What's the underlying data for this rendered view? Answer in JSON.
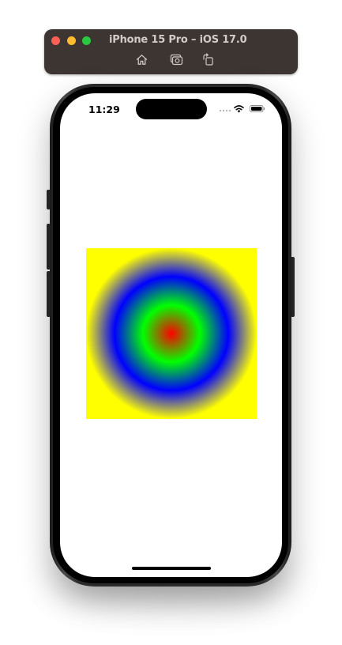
{
  "simulator": {
    "title": "iPhone 15 Pro – iOS 17.0",
    "toolbar": {
      "home_icon": "home-icon",
      "screenshot_icon": "screenshot-icon",
      "rotate_icon": "rotate-icon"
    },
    "window_controls": [
      "close",
      "minimize",
      "zoom"
    ]
  },
  "status_bar": {
    "time": "11:29",
    "icons": [
      "signal-icon",
      "wifi-icon",
      "battery-icon"
    ]
  },
  "content": {
    "gradient": {
      "type": "radial",
      "colors": [
        "#ff0000",
        "#00ff00",
        "#0000ff",
        "#ffff00"
      ]
    }
  },
  "colors": {
    "titlebar": "#3d3531",
    "close": "#fe5f57",
    "minimize": "#febc2e",
    "zoom": "#28c840",
    "screen_background": "#ffffff"
  }
}
